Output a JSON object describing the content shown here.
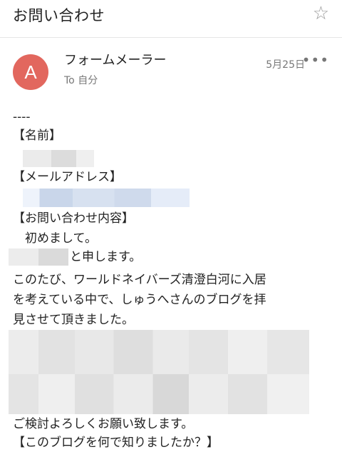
{
  "header": {
    "subject": "お問い合わせ",
    "star_icon": "star-outline-icon"
  },
  "message": {
    "avatar_letter": "A",
    "sender": "フォームメーラー",
    "recipient": "To 自分",
    "date": "5月25日",
    "more_label": "•••"
  },
  "body": {
    "separator": "----",
    "name_heading": "【名前】",
    "email_heading": "【メールアドレス】",
    "inquiry_heading": "【お問い合わせ内容】",
    "greeting": "　初めまして。",
    "self_intro": "と申します。",
    "line1": "このたび、ワールドネイバーズ清澄白河に入居",
    "line2": "を考えている中で、しゅうへさんのブログを拝",
    "line3": "見させて頂きました。",
    "closing": "ご検討よろしくお願い致します。",
    "question_heading": "【このブログを何で知りましたか？】"
  },
  "colors": {
    "avatar": "#e2675e",
    "link_redaction": "#dfe8f8"
  }
}
